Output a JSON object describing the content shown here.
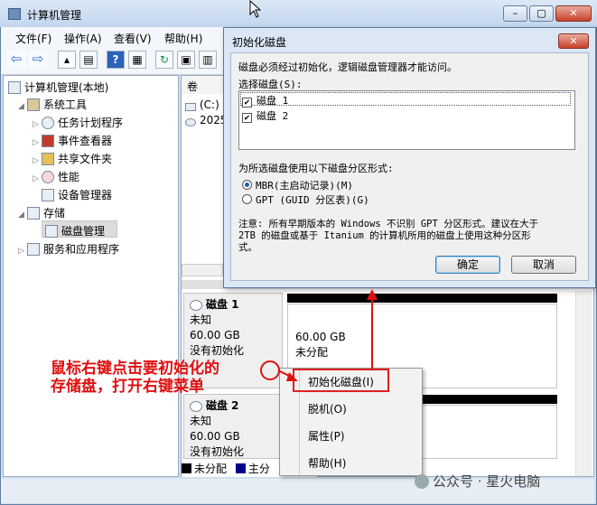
{
  "window": {
    "title": "计算机管理",
    "minimize": "–",
    "maximize": "▢",
    "close": "✕"
  },
  "menubar": [
    {
      "label": "文件(F)"
    },
    {
      "label": "操作(A)"
    },
    {
      "label": "查看(V)"
    },
    {
      "label": "帮助(H)"
    }
  ],
  "toolbar": [
    "back-icon",
    "forward-icon",
    "up-folder-icon",
    "show-tree-icon",
    "help-icon",
    "properties-icon",
    "refresh-icon",
    "export-icon",
    "help-topics-icon"
  ],
  "tree": {
    "root": "计算机管理(本地)",
    "system_tools": "系统工具",
    "task_scheduler": "任务计划程序",
    "event_viewer": "事件查看器",
    "shared_folders": "共享文件夹",
    "performance": "性能",
    "device_manager": "设备管理器",
    "storage": "存储",
    "disk_management": "磁盘管理",
    "services": "服务和应用程序"
  },
  "volumes": {
    "header": "卷",
    "row1": "(C:)",
    "row2": "2025"
  },
  "disks": [
    {
      "name": "磁盘 1",
      "type": "未知",
      "size": "60.00 GB",
      "status": "没有初始化",
      "part_size": "60.00 GB",
      "part_status": "未分配"
    },
    {
      "name": "磁盘 2",
      "type": "未知",
      "size": "60.00 GB",
      "status": "没有初始化"
    }
  ],
  "legend": {
    "unallocated": "未分配",
    "primary": "主分",
    "unallocated_color": "#000000",
    "primary_color": "#00008b"
  },
  "dialog": {
    "title": "初始化磁盘",
    "close": "✕",
    "intro": "磁盘必须经过初始化，逻辑磁盘管理器才能访问。",
    "select_label": "选择磁盘(S):",
    "disks": [
      {
        "label": "磁盘 1",
        "checked": "✔"
      },
      {
        "label": "磁盘 2",
        "checked": "✔"
      }
    ],
    "style_label": "为所选磁盘使用以下磁盘分区形式:",
    "mbr": "MBR(主启动记录)(M)",
    "gpt": "GPT (GUID 分区表)(G)",
    "note_line1": "注意: 所有早期版本的 Windows 不识别 GPT 分区形式。建议在大于",
    "note_line2": "2TB 的磁盘或基于 Itanium 的计算机所用的磁盘上使用这种分区形",
    "note_line3": "式。",
    "ok": "确定",
    "cancel": "取消"
  },
  "context_menu": [
    {
      "label": "初始化磁盘(I)"
    },
    {
      "label": "脱机(O)"
    },
    {
      "label": "属性(P)"
    },
    {
      "label": "帮助(H)"
    }
  ],
  "annotation": {
    "line1": "鼠标右键点击要初始化的",
    "line2": "存储盘，打开右键菜单",
    "color": "#e01010"
  },
  "watermark": "公众号 · 星火电脑"
}
